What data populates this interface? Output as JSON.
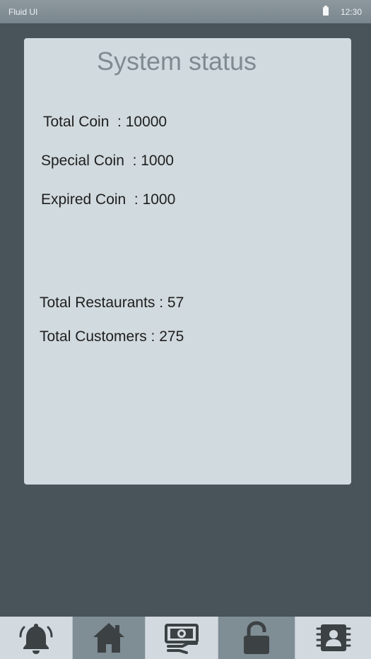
{
  "status_bar": {
    "app_name": "Fluid UI",
    "time": "12:30",
    "battery_icon": "battery-icon"
  },
  "card": {
    "title": "System status",
    "stats": {
      "total_coin": "Total Coin  : 10000",
      "special_coin": "Special Coin  : 1000",
      "expired_coin": "Expired Coin  : 1000",
      "total_restaurants": "Total Restaurants : 57",
      "total_customers": "Total Customers : 275"
    }
  },
  "bottom_nav": {
    "items": [
      {
        "icon": "bell-icon",
        "active": false
      },
      {
        "icon": "home-icon",
        "active": true
      },
      {
        "icon": "money-icon",
        "active": false
      },
      {
        "icon": "unlock-icon",
        "active": true
      },
      {
        "icon": "contact-card-icon",
        "active": false
      }
    ]
  },
  "colors": {
    "background": "#485459",
    "card": "#d1dade",
    "title": "#7f8b91",
    "nav_light": "#d3dadf",
    "nav_dark": "#7f8d95",
    "icon": "#3c4144"
  }
}
